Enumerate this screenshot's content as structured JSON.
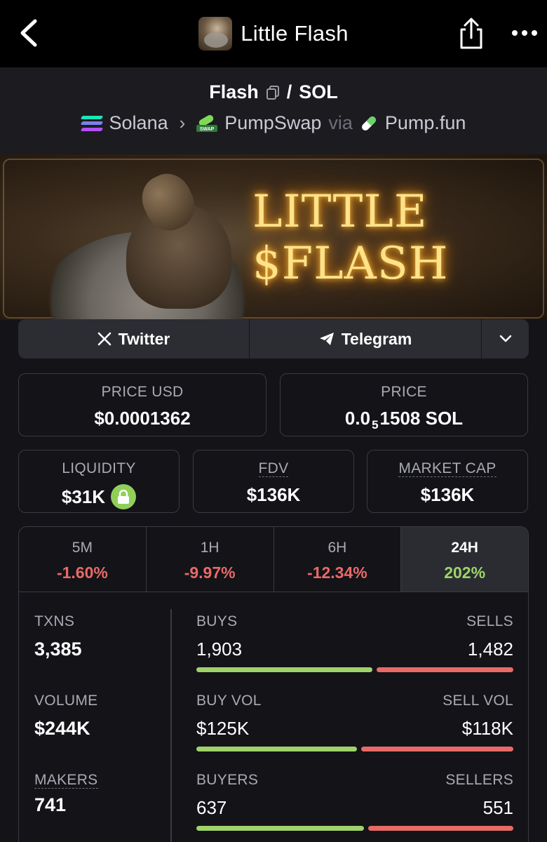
{
  "nav": {
    "title": "Little Flash"
  },
  "pair": {
    "base": "Flash",
    "separator": "/",
    "quote": "SOL",
    "chain": "Solana",
    "dex": "PumpSwap",
    "via": "via",
    "launchpad": "Pump.fun"
  },
  "banner": {
    "line1": "LITTLE",
    "line2": "$FLASH"
  },
  "social": {
    "twitter": "Twitter",
    "telegram": "Telegram"
  },
  "prices": {
    "usd_label": "PRICE USD",
    "usd_value": "$0.0001362",
    "native_label": "PRICE",
    "native_prefix": "0.0",
    "native_zeros": "5",
    "native_digits": "1508 SOL"
  },
  "metrics": {
    "liquidity_label": "LIQUIDITY",
    "liquidity_value": "$31K",
    "fdv_label": "FDV",
    "fdv_value": "$136K",
    "mcap_label": "MARKET CAP",
    "mcap_value": "$136K"
  },
  "timeframes": [
    {
      "label": "5M",
      "change": "-1.60%"
    },
    {
      "label": "1H",
      "change": "-9.97%"
    },
    {
      "label": "6H",
      "change": "-12.34%"
    },
    {
      "label": "24H",
      "change": "202%"
    }
  ],
  "stats": {
    "txns_label": "TXNS",
    "txns_value": "3,385",
    "volume_label": "VOLUME",
    "volume_value": "$244K",
    "makers_label": "MAKERS",
    "makers_value": "741",
    "buys_label": "BUYS",
    "buys_value": "1,903",
    "sells_label": "SELLS",
    "sells_value": "1,482",
    "buy_ratio": 0.562,
    "buyvol_label": "BUY VOL",
    "buyvol_value": "$125K",
    "sellvol_label": "SELL VOL",
    "sellvol_value": "$118K",
    "buyvol_ratio": 0.514,
    "buyers_label": "BUYERS",
    "buyers_value": "637",
    "sellers_label": "SELLERS",
    "sellers_value": "551",
    "buyers_ratio": 0.536
  },
  "colors": {
    "positive": "#9fd36a",
    "negative": "#e86a67",
    "background": "#131318"
  }
}
